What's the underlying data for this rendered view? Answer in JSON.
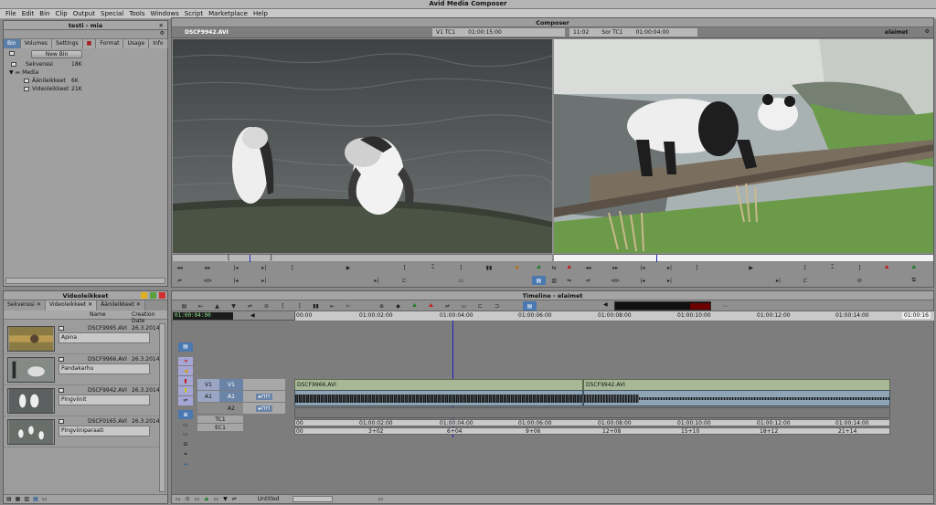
{
  "app": {
    "title": "Avid Media Composer"
  },
  "menu": [
    "File",
    "Edit",
    "Bin",
    "Clip",
    "Output",
    "Special",
    "Tools",
    "Windows",
    "Script",
    "Marketplace",
    "Help"
  ],
  "project": {
    "title": "testi - mia",
    "tabs": [
      "Bin",
      "Volumes",
      "Settings",
      "Format",
      "Usage",
      "Info"
    ],
    "new_bin": "New Bin",
    "items": [
      {
        "name": "Sekvenssi",
        "size": "18K"
      },
      {
        "name": "Media",
        "size": ""
      },
      {
        "name": "Äänileikkeet",
        "size": "6K"
      },
      {
        "name": "Videoleikkeet",
        "size": "21K"
      }
    ]
  },
  "composer": {
    "title": "Composer",
    "source_name": "DSCF9942.AVI",
    "tc1_label": "V1  TC1",
    "tc1_value": "01:00:15:00",
    "duration": "11:02",
    "tc2_label": "Sor  TC1",
    "tc2_value": "01:00:04:00",
    "record_name": "elaimet"
  },
  "bin": {
    "title": "Videoleikkeet",
    "tabs": [
      "Sekvenssi",
      "Videoleikkeet",
      "Äänileikkeet"
    ],
    "columns": [
      "Name",
      "Creation Date"
    ],
    "rows": [
      {
        "file": "DSCF9995.AVI",
        "date": "26.3.2014",
        "label": "Apina"
      },
      {
        "file": "DSCF9966.AVI",
        "date": "26.3.2014",
        "label": "Pandakarhu"
      },
      {
        "file": "DSCF9942.AVI",
        "date": "26.3.2014",
        "label": "Pingviinit"
      },
      {
        "file": "DSCF0165.AVI",
        "date": "26.3.2014",
        "label": "Pingviiniparaati"
      }
    ],
    "footer": "Untitled"
  },
  "timeline": {
    "title": "Timeline - elaimet",
    "timecode": "01:00:04:00",
    "ruler": [
      "00:00",
      "01:00:02:00",
      "01:00:04:00",
      "01:00:06:00",
      "01:00:08:00",
      "01:00:10:00",
      "01:00:12:00",
      "01:00:14:00",
      "01:00:16"
    ],
    "tc1_ruler": [
      "00",
      "01:00:02:00",
      "01:00:04:00",
      "01:00:06:00",
      "01:00:08:00",
      "01:00:10:00",
      "01:00:12:00",
      "01:00:14:00"
    ],
    "ec1_ruler": [
      "00",
      "3+02",
      "6+04",
      "9+06",
      "12+08",
      "15+10",
      "18+12",
      "21+14"
    ],
    "tracks": {
      "v1": "V1",
      "a1": "A1",
      "a2": "A2",
      "tc1": "TC1",
      "ec1": "EC1"
    },
    "clips": [
      {
        "name": "DSCF9966.AVI"
      },
      {
        "name": "DSCF9942.AVI"
      }
    ]
  }
}
